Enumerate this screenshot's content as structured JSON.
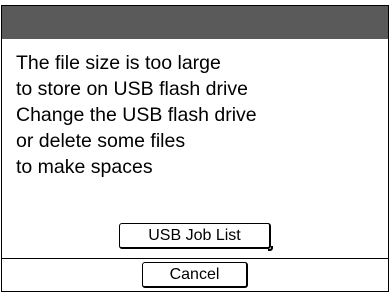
{
  "dialog": {
    "message_lines": [
      "The file size is too large",
      "to store on USB flash drive",
      "Change the USB flash drive",
      "or delete some files",
      "to make spaces"
    ],
    "usb_job_list_label": "USB Job List",
    "cancel_label": "Cancel"
  },
  "colors": {
    "title_bar": "#5a5a5a",
    "background": "#ffffff",
    "border": "#000000"
  }
}
